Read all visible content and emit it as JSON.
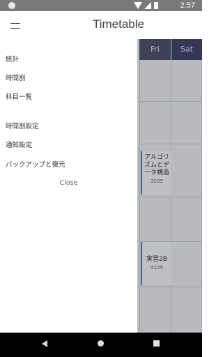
{
  "status_bar": {
    "time": "2:57"
  },
  "app_bar": {
    "title": "Timetable"
  },
  "timetable": {
    "days": [
      "Fri",
      "Sat"
    ],
    "courses": [
      {
        "name": "アルゴリズムとデータ構造",
        "room": "3205"
      },
      {
        "name": "実習2B",
        "room": "4105"
      }
    ]
  },
  "drawer": {
    "items": [
      "統計",
      "時間割",
      "科目一覧",
      "時間割設定",
      "通知設定",
      "バックアップと復元"
    ],
    "close_label": "Close"
  }
}
